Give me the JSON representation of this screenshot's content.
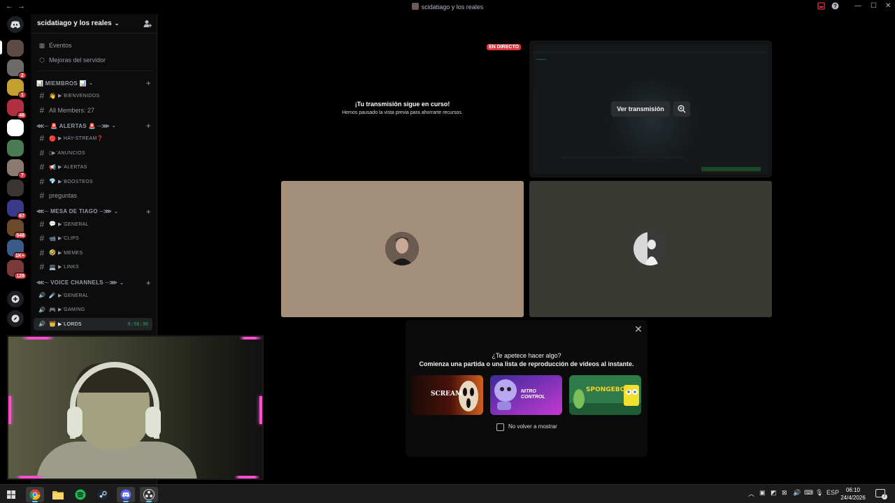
{
  "window": {
    "title": "scidatiago y los reales"
  },
  "rail": {
    "servers": [
      {
        "name": "server-1",
        "badge": "",
        "color": "#5c4a44"
      },
      {
        "name": "server-2",
        "badge": "2",
        "color": "#6d6a68"
      },
      {
        "name": "server-3",
        "badge": "1",
        "color": "#c4a030"
      },
      {
        "name": "server-4",
        "badge": "46",
        "color": "#b03040"
      },
      {
        "name": "server-5",
        "badge": "",
        "color": "#ffffff"
      },
      {
        "name": "server-6",
        "badge": "",
        "color": "#4a7a52"
      },
      {
        "name": "server-7",
        "badge": "7",
        "color": "#8a7a70"
      },
      {
        "name": "server-8",
        "badge": "",
        "color": "#3a3432"
      },
      {
        "name": "server-9",
        "badge": "67",
        "color": "#3a3a8a"
      },
      {
        "name": "server-10",
        "badge": "548",
        "color": "#6a4a2a"
      },
      {
        "name": "server-11",
        "badge": "1K+",
        "color": "#3a5a8a"
      },
      {
        "name": "server-12",
        "badge": "128",
        "color": "#7a3a3a"
      }
    ]
  },
  "sidebar": {
    "guild_name": "scidatiago y los reales",
    "top_items": [
      {
        "label": "Eventos",
        "icon": "calendar-icon"
      },
      {
        "label": "Mejoras del servidor",
        "icon": "boost-icon"
      }
    ],
    "categories": [
      {
        "label": "📊 MIEMBROS 📊",
        "channels": [
          {
            "emoji": "👋",
            "label": "▶¨BIENVENIDOS",
            "type": "text",
            "smallcaps": true
          },
          {
            "emoji": "",
            "label": "All Members: 27",
            "type": "text",
            "smallcaps": false
          }
        ]
      },
      {
        "label": "⋘─ 🚨 ALERTAS 🚨 ─⋙",
        "channels": [
          {
            "emoji": "🔴",
            "label": "▶ HAY-STREAM❓",
            "type": "text",
            "smallcaps": true
          },
          {
            "emoji": "",
            "label": "▯▶¨ANUNCIOS",
            "type": "text",
            "smallcaps": true
          },
          {
            "emoji": "📢",
            "label": "▶¨ALERTAS",
            "type": "text",
            "smallcaps": true
          },
          {
            "emoji": "💎",
            "label": "▶¨BOOSTEOS",
            "type": "text",
            "smallcaps": true
          },
          {
            "emoji": "",
            "label": "preguntas",
            "type": "text",
            "smallcaps": false
          }
        ]
      },
      {
        "label": "⋘─ MESA DE TIAGO ─⋙",
        "channels": [
          {
            "emoji": "💬",
            "label": "▶¨GENERAL",
            "type": "text",
            "smallcaps": true
          },
          {
            "emoji": "📹",
            "label": "▶¨CLIPS",
            "type": "text",
            "smallcaps": true
          },
          {
            "emoji": "🤣",
            "label": "▶¨MEMES",
            "type": "text",
            "smallcaps": true
          },
          {
            "emoji": "💻",
            "label": "▶¨LINKS",
            "type": "text",
            "smallcaps": true
          }
        ]
      },
      {
        "label": "⋘─ VOICE CHANNELS ─⋙",
        "channels": [
          {
            "emoji": "☄️",
            "label": "▶¨GENERAL",
            "type": "voice",
            "smallcaps": true
          },
          {
            "emoji": "🎮",
            "label": "▶¨GAMING",
            "type": "voice",
            "smallcaps": true
          },
          {
            "emoji": "👑",
            "label": "▶¨LORDS",
            "type": "voice",
            "smallcaps": true,
            "active": true,
            "timer": "9:58:36"
          }
        ]
      }
    ]
  },
  "stage": {
    "live_badge": "EN DIRECTO",
    "paused_title": "¡Tu transmisión sigue en curso!",
    "paused_subtitle": "Hemos pausado la vista previa para ahorrarte recursos.",
    "watch_button": "Ver transmisión",
    "tiles": [
      {
        "bg": "#a38f7a"
      },
      {
        "bg": "#3a3a34"
      }
    ]
  },
  "activity_popup": {
    "question": "¿Te apetece hacer algo?",
    "description": "Comienza una partida o una lista de reproducción de vídeos al instante.",
    "cards": [
      {
        "label": "SCREAM",
        "bg": "#6a1a0e"
      },
      {
        "label": "NITRO CONTROL",
        "bg": "#5a2aa8"
      },
      {
        "label": "SPONGEBOB",
        "bg": "#2a6a3a"
      }
    ],
    "checkbox_label": "No volver a mostrar"
  },
  "taskbar": {
    "apps": [
      "start-icon",
      "chrome-icon",
      "explorer-icon",
      "spotify-icon",
      "steam-icon",
      "discord-icon",
      "obs-icon"
    ],
    "language": "ESP",
    "time": "06:10",
    "date": "24/4/2026",
    "notifications": "7"
  }
}
